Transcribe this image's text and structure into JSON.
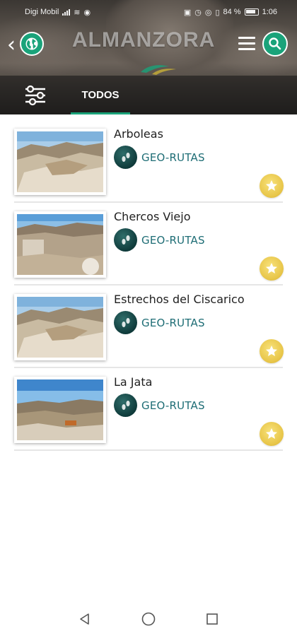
{
  "status_bar": {
    "carrier": "Digi Mobil",
    "battery": "84 %",
    "time": "1:06"
  },
  "app": {
    "title": "ALMANZORA"
  },
  "tabs": [
    {
      "label": "TODOS",
      "active": true
    }
  ],
  "items": [
    {
      "title": "Arboleas",
      "category": "GEO-RUTAS",
      "category_icon": "footprints-icon",
      "favorite_icon": "star-icon"
    },
    {
      "title": "Chercos Viejo",
      "category": "GEO-RUTAS",
      "category_icon": "footprints-icon",
      "favorite_icon": "star-icon"
    },
    {
      "title": "Estrechos del Ciscarico",
      "category": "GEO-RUTAS",
      "category_icon": "footprints-icon",
      "favorite_icon": "star-icon"
    },
    {
      "title": "La Jata",
      "category": "GEO-RUTAS",
      "category_icon": "footprints-icon",
      "favorite_icon": "star-icon"
    }
  ],
  "colors": {
    "accent": "#1aa37a",
    "category_text": "#1e6d75",
    "star_bg": "#e8c64a"
  }
}
